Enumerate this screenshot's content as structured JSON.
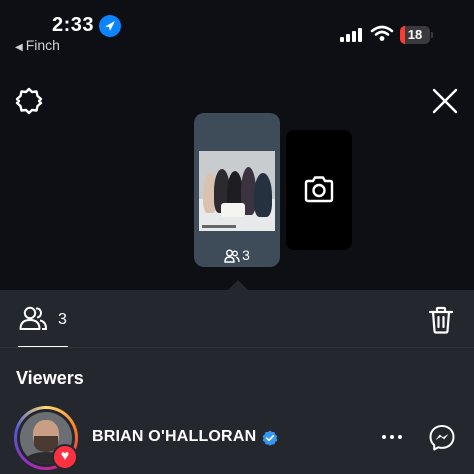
{
  "status_bar": {
    "time": "2:33",
    "back_app": "Finch",
    "battery": "18",
    "battery_level": 0.18,
    "battery_color": "#ff3b30"
  },
  "toolbar": {
    "settings_icon": "gear-icon",
    "close_icon": "close-icon"
  },
  "story": {
    "viewer_count": "3",
    "camera_icon": "camera-icon"
  },
  "sheet": {
    "viewers_tab_count": "3",
    "delete_icon": "trash-icon",
    "heading": "Viewers",
    "viewers": [
      {
        "name": "BRIAN O'HALLORAN",
        "verified": true,
        "reaction": "heart",
        "reaction_color": "#ff3040"
      }
    ]
  },
  "colors": {
    "background": "#0d0f14",
    "sheet": "#24272e",
    "accent": "#0a84ff",
    "verified": "#3797f0"
  }
}
